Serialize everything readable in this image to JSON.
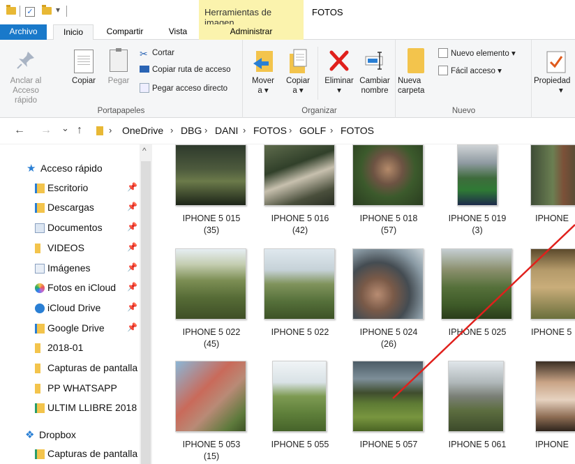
{
  "window": {
    "context_tab": "Herramientas de imagen",
    "title": "FOTOS"
  },
  "tabs": {
    "archivo": "Archivo",
    "inicio": "Inicio",
    "compartir": "Compartir",
    "vista": "Vista",
    "administrar": "Administrar"
  },
  "ribbon": {
    "portapapeles": {
      "label": "Portapapeles",
      "anclar_1": "Anclar al",
      "anclar_2": "Acceso rápido",
      "copiar": "Copiar",
      "pegar": "Pegar",
      "cortar": "Cortar",
      "copiar_ruta": "Copiar ruta de acceso",
      "pegar_acceso": "Pegar acceso directo"
    },
    "organizar": {
      "label": "Organizar",
      "mover_1": "Mover",
      "mover_2": "a ▾",
      "copiar_1": "Copiar",
      "copiar_2": "a ▾",
      "eliminar_1": "Eliminar",
      "eliminar_2": "▾",
      "cambiar_1": "Cambiar",
      "cambiar_2": "nombre"
    },
    "nuevo": {
      "label": "Nuevo",
      "carpeta_1": "Nueva",
      "carpeta_2": "carpeta",
      "elemento": "Nuevo elemento ▾",
      "facil": "Fácil acceso ▾"
    },
    "abrir": {
      "propiedades": "Propiedad",
      "propiedades_2": "▾"
    }
  },
  "address": {
    "back": "←",
    "forward": "→",
    "recent": "⌄",
    "up": "↑",
    "crumbs": [
      "OneDrive",
      "DBG",
      "DANI",
      "FOTOS",
      "GOLF",
      "FOTOS"
    ],
    "sep": "›"
  },
  "nav": {
    "items": [
      {
        "label": "Acceso rápido"
      },
      {
        "label": "Escritorio"
      },
      {
        "label": "Descargas"
      },
      {
        "label": "Documentos"
      },
      {
        "label": "VIDEOS"
      },
      {
        "label": "Imágenes"
      },
      {
        "label": "Fotos en iCloud"
      },
      {
        "label": "iCloud Drive"
      },
      {
        "label": "Google Drive"
      },
      {
        "label": "2018-01"
      },
      {
        "label": "Capturas de pantalla"
      },
      {
        "label": "PP WHATSAPP"
      },
      {
        "label": "ULTIM LLIBRE 2018"
      },
      {
        "label": "Dropbox"
      },
      {
        "label": "Capturas de pantalla"
      }
    ],
    "pin": "📌",
    "scroll_up": "^"
  },
  "files": [
    {
      "name": "IPHONE 5 015",
      "sub": "(35)"
    },
    {
      "name": "IPHONE 5 016",
      "sub": "(42)"
    },
    {
      "name": "IPHONE 5 018",
      "sub": "(57)"
    },
    {
      "name": "IPHONE 5 019",
      "sub": "(3)"
    },
    {
      "name": "IPHONE",
      "sub": ""
    },
    {
      "name": "IPHONE 5 022",
      "sub": "(45)"
    },
    {
      "name": "IPHONE 5 022",
      "sub": ""
    },
    {
      "name": "IPHONE 5 024",
      "sub": "(26)"
    },
    {
      "name": "IPHONE 5 025",
      "sub": ""
    },
    {
      "name": "IPHONE 5",
      "sub": ""
    },
    {
      "name": "IPHONE 5 053",
      "sub": "(15)"
    },
    {
      "name": "IPHONE 5 055",
      "sub": ""
    },
    {
      "name": "IPHONE 5 057",
      "sub": ""
    },
    {
      "name": "IPHONE 5 061",
      "sub": ""
    },
    {
      "name": "IPHONE",
      "sub": ""
    }
  ],
  "colors": {
    "accent": "#1979ca",
    "context_tab": "#fbf3ad",
    "annotation": "#e0201c"
  }
}
